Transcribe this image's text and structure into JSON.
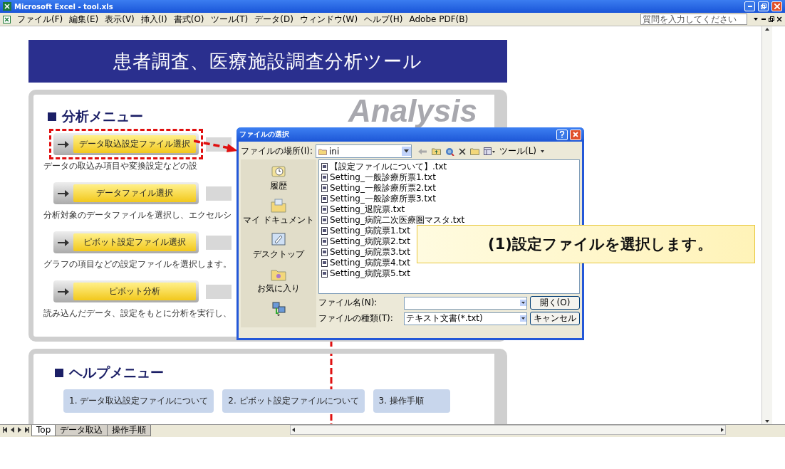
{
  "window": {
    "title": "Microsoft Excel - tool.xls"
  },
  "menu_bar": [
    "ファイル(F)",
    "編集(E)",
    "表示(V)",
    "挿入(I)",
    "書式(O)",
    "ツール(T)",
    "データ(D)",
    "ウィンドウ(W)",
    "ヘルプ(H)",
    "Adobe PDF(B)"
  ],
  "help_field": {
    "placeholder": "質問を入力してください"
  },
  "sheet": {
    "title": "患者調査、医療施設調査分析ツール",
    "banner_text": "Analysis",
    "analysis_menu": {
      "heading": "分析メニュー",
      "items": [
        {
          "label": "データ取込設定ファイル選択",
          "description": "データの取込み項目や変換設定などの設",
          "highlighted": true
        },
        {
          "label": "データファイル選択",
          "description": "分析対象のデータファイルを選択し、エクセルシ",
          "highlighted": false
        },
        {
          "label": "ピボット設定ファイル選択",
          "description": "グラフの項目などの設定ファイルを選択します。",
          "highlighted": false
        },
        {
          "label": "ピボット分析",
          "description": "読み込んだデータ、設定をもとに分析を実行し、",
          "highlighted": false
        }
      ]
    },
    "help_menu": {
      "heading": "ヘルプメニュー",
      "links": [
        "1. データ取込設定ファイルについて",
        "2. ピボット設定ファイルについて",
        "3. 操作手順"
      ]
    }
  },
  "dialog": {
    "title": "ファイルの選択",
    "look_in_label": "ファイルの場所(I):",
    "look_in_value": "ini",
    "tools_menu": "ツール(L)",
    "places": [
      "履歴",
      "マイ ドキュメント",
      "デスクトップ",
      "お気に入り"
    ],
    "files": [
      "【設定ファイルについて】.txt",
      "Setting_一般診療所票1.txt",
      "Setting_一般診療所票2.txt",
      "Setting_一般診療所票3.txt",
      "Setting_退院票.txt",
      "Setting_病院二次医療圏マスタ.txt",
      "Setting_病院票1.txt",
      "Setting_病院票2.txt",
      "Setting_病院票3.txt",
      "Setting_病院票4.txt",
      "Setting_病院票5.txt"
    ],
    "file_name_label": "ファイル名(N):",
    "file_type_label": "ファイルの種類(T):",
    "file_type_value": "テキスト文書(*.txt)",
    "buttons": [
      "開く(O)",
      "キャンセル"
    ]
  },
  "callout": "(1)設定ファイルを選択します。",
  "sheet_tabs": [
    {
      "label": "Top",
      "selected": true
    },
    {
      "label": "データ取込",
      "selected": false
    },
    {
      "label": "操作手順",
      "selected": false
    }
  ]
}
